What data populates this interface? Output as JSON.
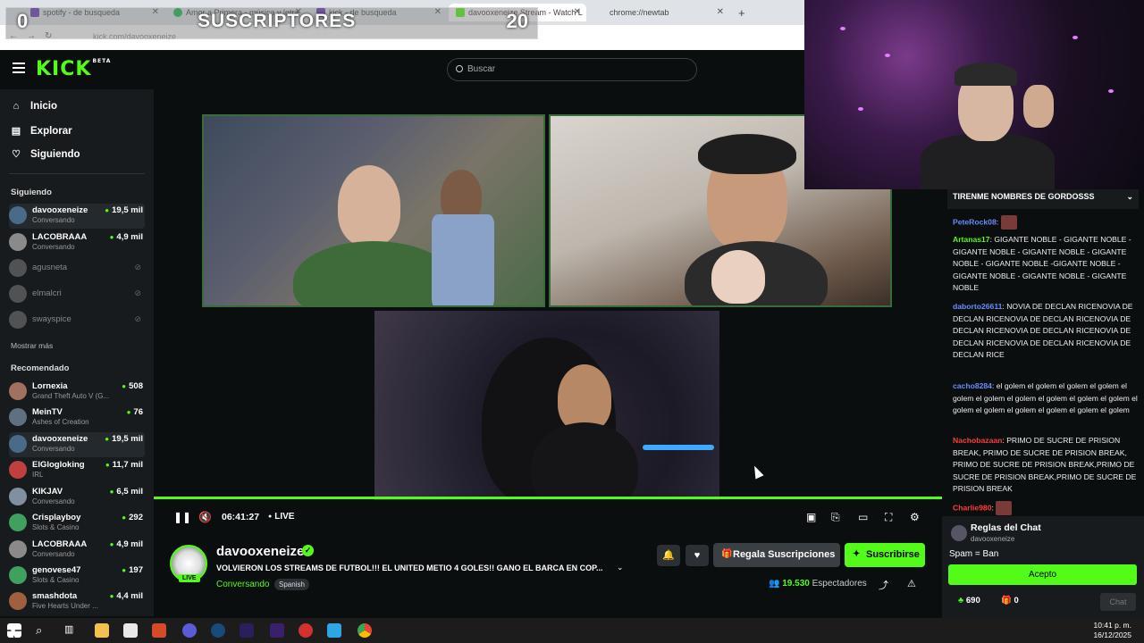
{
  "browser": {
    "tabs": [
      {
        "title": "spotify - de busqueda",
        "color": "#6a3db8"
      },
      {
        "title": "Amor a Primera - música y letra",
        "color": "#1db954"
      },
      {
        "title": "kick - de busqueda",
        "color": "#6a3db8"
      },
      {
        "title": "davooxeneize Stream - Watch L",
        "color": "#53fc18"
      },
      {
        "title": "chrome://newtab",
        "color": ""
      }
    ],
    "new_tab": "+",
    "url": "kick.com/davooxeneize"
  },
  "overlay": {
    "left_count": "0",
    "title": "SUSCRIPTORES",
    "right_count": "20"
  },
  "header": {
    "logo": "KICK",
    "logo_tag": "BETA",
    "search_placeholder": "Buscar"
  },
  "nav": {
    "home": "Inicio",
    "explore": "Explorar",
    "following": "Siguiendo"
  },
  "sidebar": {
    "following_title": "Siguiendo",
    "following": [
      {
        "name": "davooxeneize",
        "category": "Conversando",
        "viewers": "19,5 mil",
        "live": true,
        "color": "#4a6a8a"
      },
      {
        "name": "LACOBRAAA",
        "category": "Conversando",
        "viewers": "4,9 mil",
        "live": true,
        "color": "#8a8a8a"
      },
      {
        "name": "agusneta",
        "category": "",
        "viewers": "",
        "live": false,
        "color": "#777"
      },
      {
        "name": "elmalcri",
        "category": "",
        "viewers": "",
        "live": false,
        "color": "#777"
      },
      {
        "name": "swayspice",
        "category": "",
        "viewers": "",
        "live": false,
        "color": "#777"
      }
    ],
    "show_more": "Mostrar más",
    "recommended_title": "Recomendado",
    "recommended": [
      {
        "name": "Lornexia",
        "category": "Grand Theft Auto V (G...",
        "viewers": "508",
        "color": "#a07060"
      },
      {
        "name": "MeinTV",
        "category": "Ashes of Creation",
        "viewers": "76",
        "color": "#607080"
      },
      {
        "name": "davooxeneize",
        "category": "Conversando",
        "viewers": "19,5 mil",
        "color": "#4a6a8a"
      },
      {
        "name": "ElGlogloking",
        "category": "IRL",
        "viewers": "11,7 mil",
        "color": "#c04040"
      },
      {
        "name": "KIKJAV",
        "category": "Conversando",
        "viewers": "6,5 mil",
        "color": "#8090a0"
      },
      {
        "name": "Crisplayboy",
        "category": "Slots & Casino",
        "viewers": "292",
        "color": "#40a060"
      },
      {
        "name": "LACOBRAAA",
        "category": "Conversando",
        "viewers": "4,9 mil",
        "color": "#8a8a8a"
      },
      {
        "name": "genovese47",
        "category": "Slots & Casino",
        "viewers": "197",
        "color": "#40a060"
      },
      {
        "name": "smashdota",
        "category": "Five Hearts Under ...",
        "viewers": "4,4 mil",
        "color": "#a06040"
      }
    ]
  },
  "player": {
    "time": "06:41:27",
    "live": "LIVE"
  },
  "stream": {
    "streamer": "davooxeneize",
    "live_badge": "LIVE",
    "title": "VOLVIERON LOS STREAMS DE FUTBOL!!! EL UNITED METIO 4 GOLES!! GANO EL BARCA EN COP...",
    "category": "Conversando",
    "language": "Spanish",
    "gift_label": "Regala Suscripciones",
    "subscribe_label": "Suscribirse",
    "viewers_count": "19.530",
    "viewers_label": "Espectadores"
  },
  "chat": {
    "pinned": "TIRENME NOMBRES DE GORDOSSS",
    "messages": [
      {
        "user": "PeteRock08",
        "color": "#6a8cff",
        "text": ""
      },
      {
        "user": "Artanas17",
        "color": "#53fc18",
        "text": "GIGANTE NOBLE - GIGANTE NOBLE - GIGANTE NOBLE - GIGANTE NOBLE - GIGANTE NOBLE - GIGANTE NOBLE -GIGANTE NOBLE - GIGANTE NOBLE - GIGANTE NOBLE - GIGANTE NOBLE"
      },
      {
        "user": "daborto26611",
        "color": "#6a8cff",
        "text": "NOVIA DE DECLAN RICENOVIA DE DECLAN RICENOVIA DE DECLAN RICENOVIA DE DECLAN RICENOVIA DE DECLAN RICENOVIA DE DECLAN RICENOVIA DE DECLAN RICENOVIA DE DECLAN RICE"
      },
      {
        "user": "cacho8284",
        "color": "#6a8cff",
        "text": "el golem el golem el golem el golem el golem el golem el golem el golem el golem el golem el golem el golem el golem el golem el golem el golem"
      },
      {
        "user": "Nachobazaan",
        "color": "#ff3b3b",
        "text": "PRIMO DE SUCRE DE PRISION BREAK, PRIMO DE SUCRE DE PRISION BREAK, PRIMO DE SUCRE DE PRISION BREAK,PRIMO DE SUCRE DE PRISION BREAK,PRIMO DE SUCRE DE PRISION BREAK"
      },
      {
        "user": "Charlie980",
        "color": "#ff3b3b",
        "text": ""
      }
    ],
    "rules_title": "Reglas del Chat",
    "rules_owner": "davooxeneize",
    "rules_text": "Spam = Ban",
    "accept": "Acepto",
    "points": "690",
    "gifts": "0",
    "chat_button": "Chat"
  },
  "taskbar": {
    "time": "10:41 p. m.",
    "date": "16/12/2025"
  },
  "colors": {
    "accent": "#53fc18",
    "bg": "#0b0e0f",
    "sidebar": "#171b1e"
  }
}
